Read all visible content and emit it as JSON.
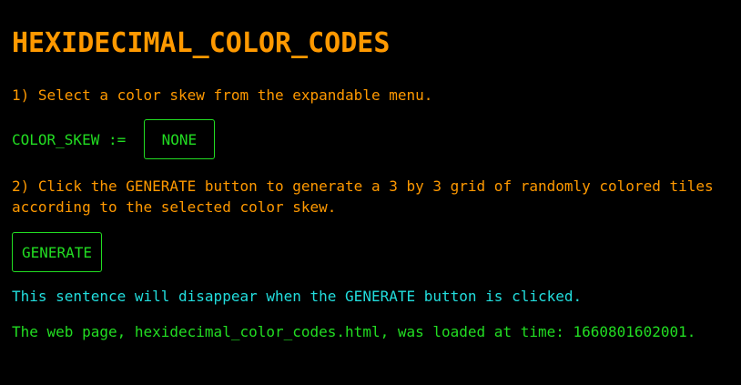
{
  "page": {
    "title": "HEXIDECIMAL_COLOR_CODES"
  },
  "steps": {
    "step1": "1) Select a color skew from the expandable menu.",
    "step2_line1": "2) Click the GENERATE button to generate a 3 by 3 grid of randomly colored tiles",
    "step2_line2": "according to the selected color skew."
  },
  "color_skew": {
    "label": "COLOR_SKEW := ",
    "selected": "NONE"
  },
  "generate": {
    "label": "GENERATE"
  },
  "notice": "This sentence will disappear when the GENERATE button is clicked.",
  "loaded_message": "The web page, hexidecimal_color_codes.html, was loaded at time: 1660801602001.",
  "colors": {
    "background": "#000000",
    "heading": "#ff9900",
    "green": "#22dd22",
    "cyan": "#22dddd"
  }
}
